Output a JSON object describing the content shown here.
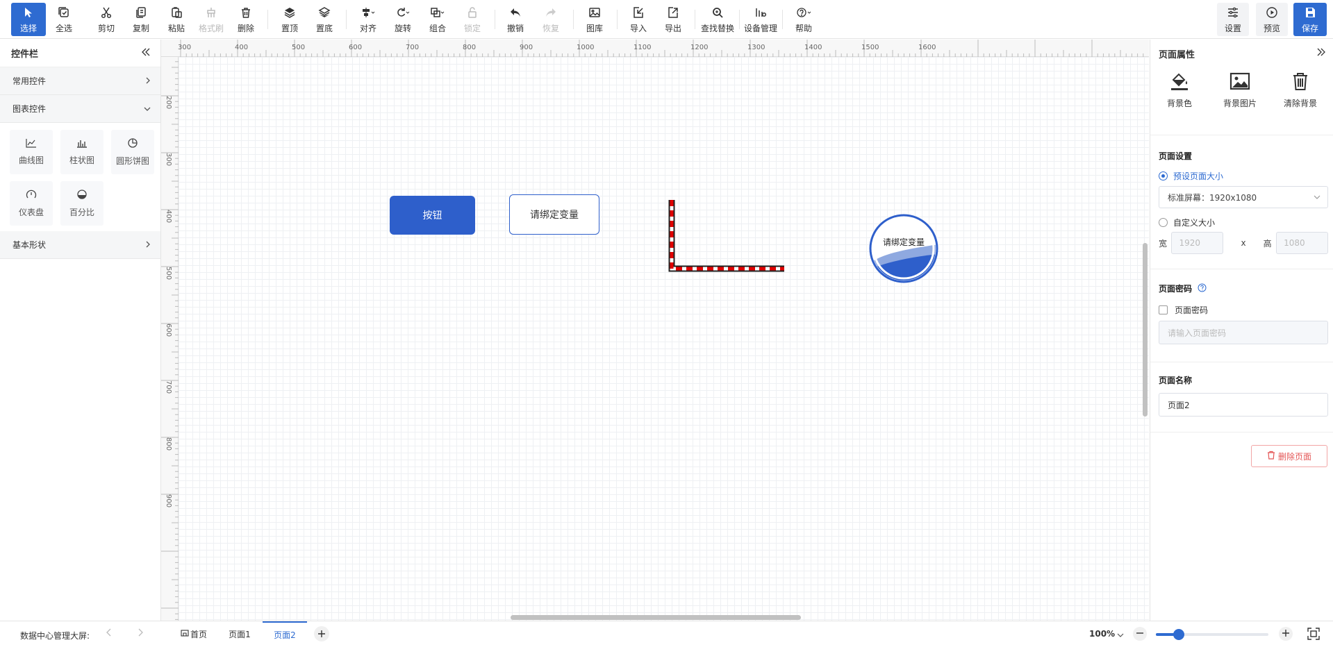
{
  "toolbar": {
    "select": "选择",
    "select_all": "全选",
    "cut": "剪切",
    "copy": "复制",
    "paste": "粘贴",
    "format_brush": "格式刷",
    "delete": "删除",
    "bring_top": "置顶",
    "send_bottom": "置底",
    "align": "对齐",
    "rotate": "旋转",
    "group": "组合",
    "lock": "锁定",
    "undo": "撤销",
    "redo": "恢复",
    "gallery": "图库",
    "import": "导入",
    "export": "导出",
    "find_replace": "查找替换",
    "device_mgmt": "设备管理",
    "help": "帮助",
    "settings": "设置",
    "preview": "预览",
    "save": "保存"
  },
  "left_panel": {
    "title": "控件栏",
    "sections": {
      "common": "常用控件",
      "charts": "图表控件",
      "shapes": "基本形状"
    },
    "widgets": [
      {
        "label": "曲线图",
        "icon": "line-chart-icon"
      },
      {
        "label": "柱状图",
        "icon": "bar-chart-icon"
      },
      {
        "label": "圆形饼图",
        "icon": "pie-chart-icon"
      },
      {
        "label": "仪表盘",
        "icon": "gauge-icon"
      },
      {
        "label": "百分比",
        "icon": "percent-icon"
      }
    ]
  },
  "rulers": {
    "top": [
      "300",
      "400",
      "500",
      "600",
      "700",
      "800",
      "900",
      "1000",
      "1100",
      "1200",
      "1300",
      "1400",
      "1500",
      "1600"
    ],
    "left": [
      "200",
      "300",
      "400",
      "500",
      "600",
      "700",
      "800",
      "900"
    ]
  },
  "canvas": {
    "button_label": "按钮",
    "text_bind_label": "请绑定变量",
    "gauge_label": "请绑定变量"
  },
  "right_panel": {
    "title": "页面属性",
    "bg_color": "背景色",
    "bg_image": "背景图片",
    "clear_bg": "清除背景",
    "page_settings": "页面设置",
    "preset_size": "预设页面大小",
    "preset_value": "标准屏幕：1920x1080",
    "custom_size": "自定义大小",
    "width_label": "宽",
    "width_value": "1920",
    "x_label": "x",
    "height_label": "高",
    "height_value": "1080",
    "password_title": "页面密码",
    "password_checkbox": "页面密码",
    "password_placeholder": "请输入页面密码",
    "name_title": "页面名称",
    "name_value": "页面2",
    "delete_page": "删除页面"
  },
  "bottom": {
    "project": "数据中心管理大屏:",
    "tabs": [
      "首页",
      "页面1",
      "页面2"
    ],
    "active_tab": "页面2",
    "zoom": "100%"
  },
  "colors": {
    "accent": "#2e6bd1",
    "danger": "#e45656"
  }
}
